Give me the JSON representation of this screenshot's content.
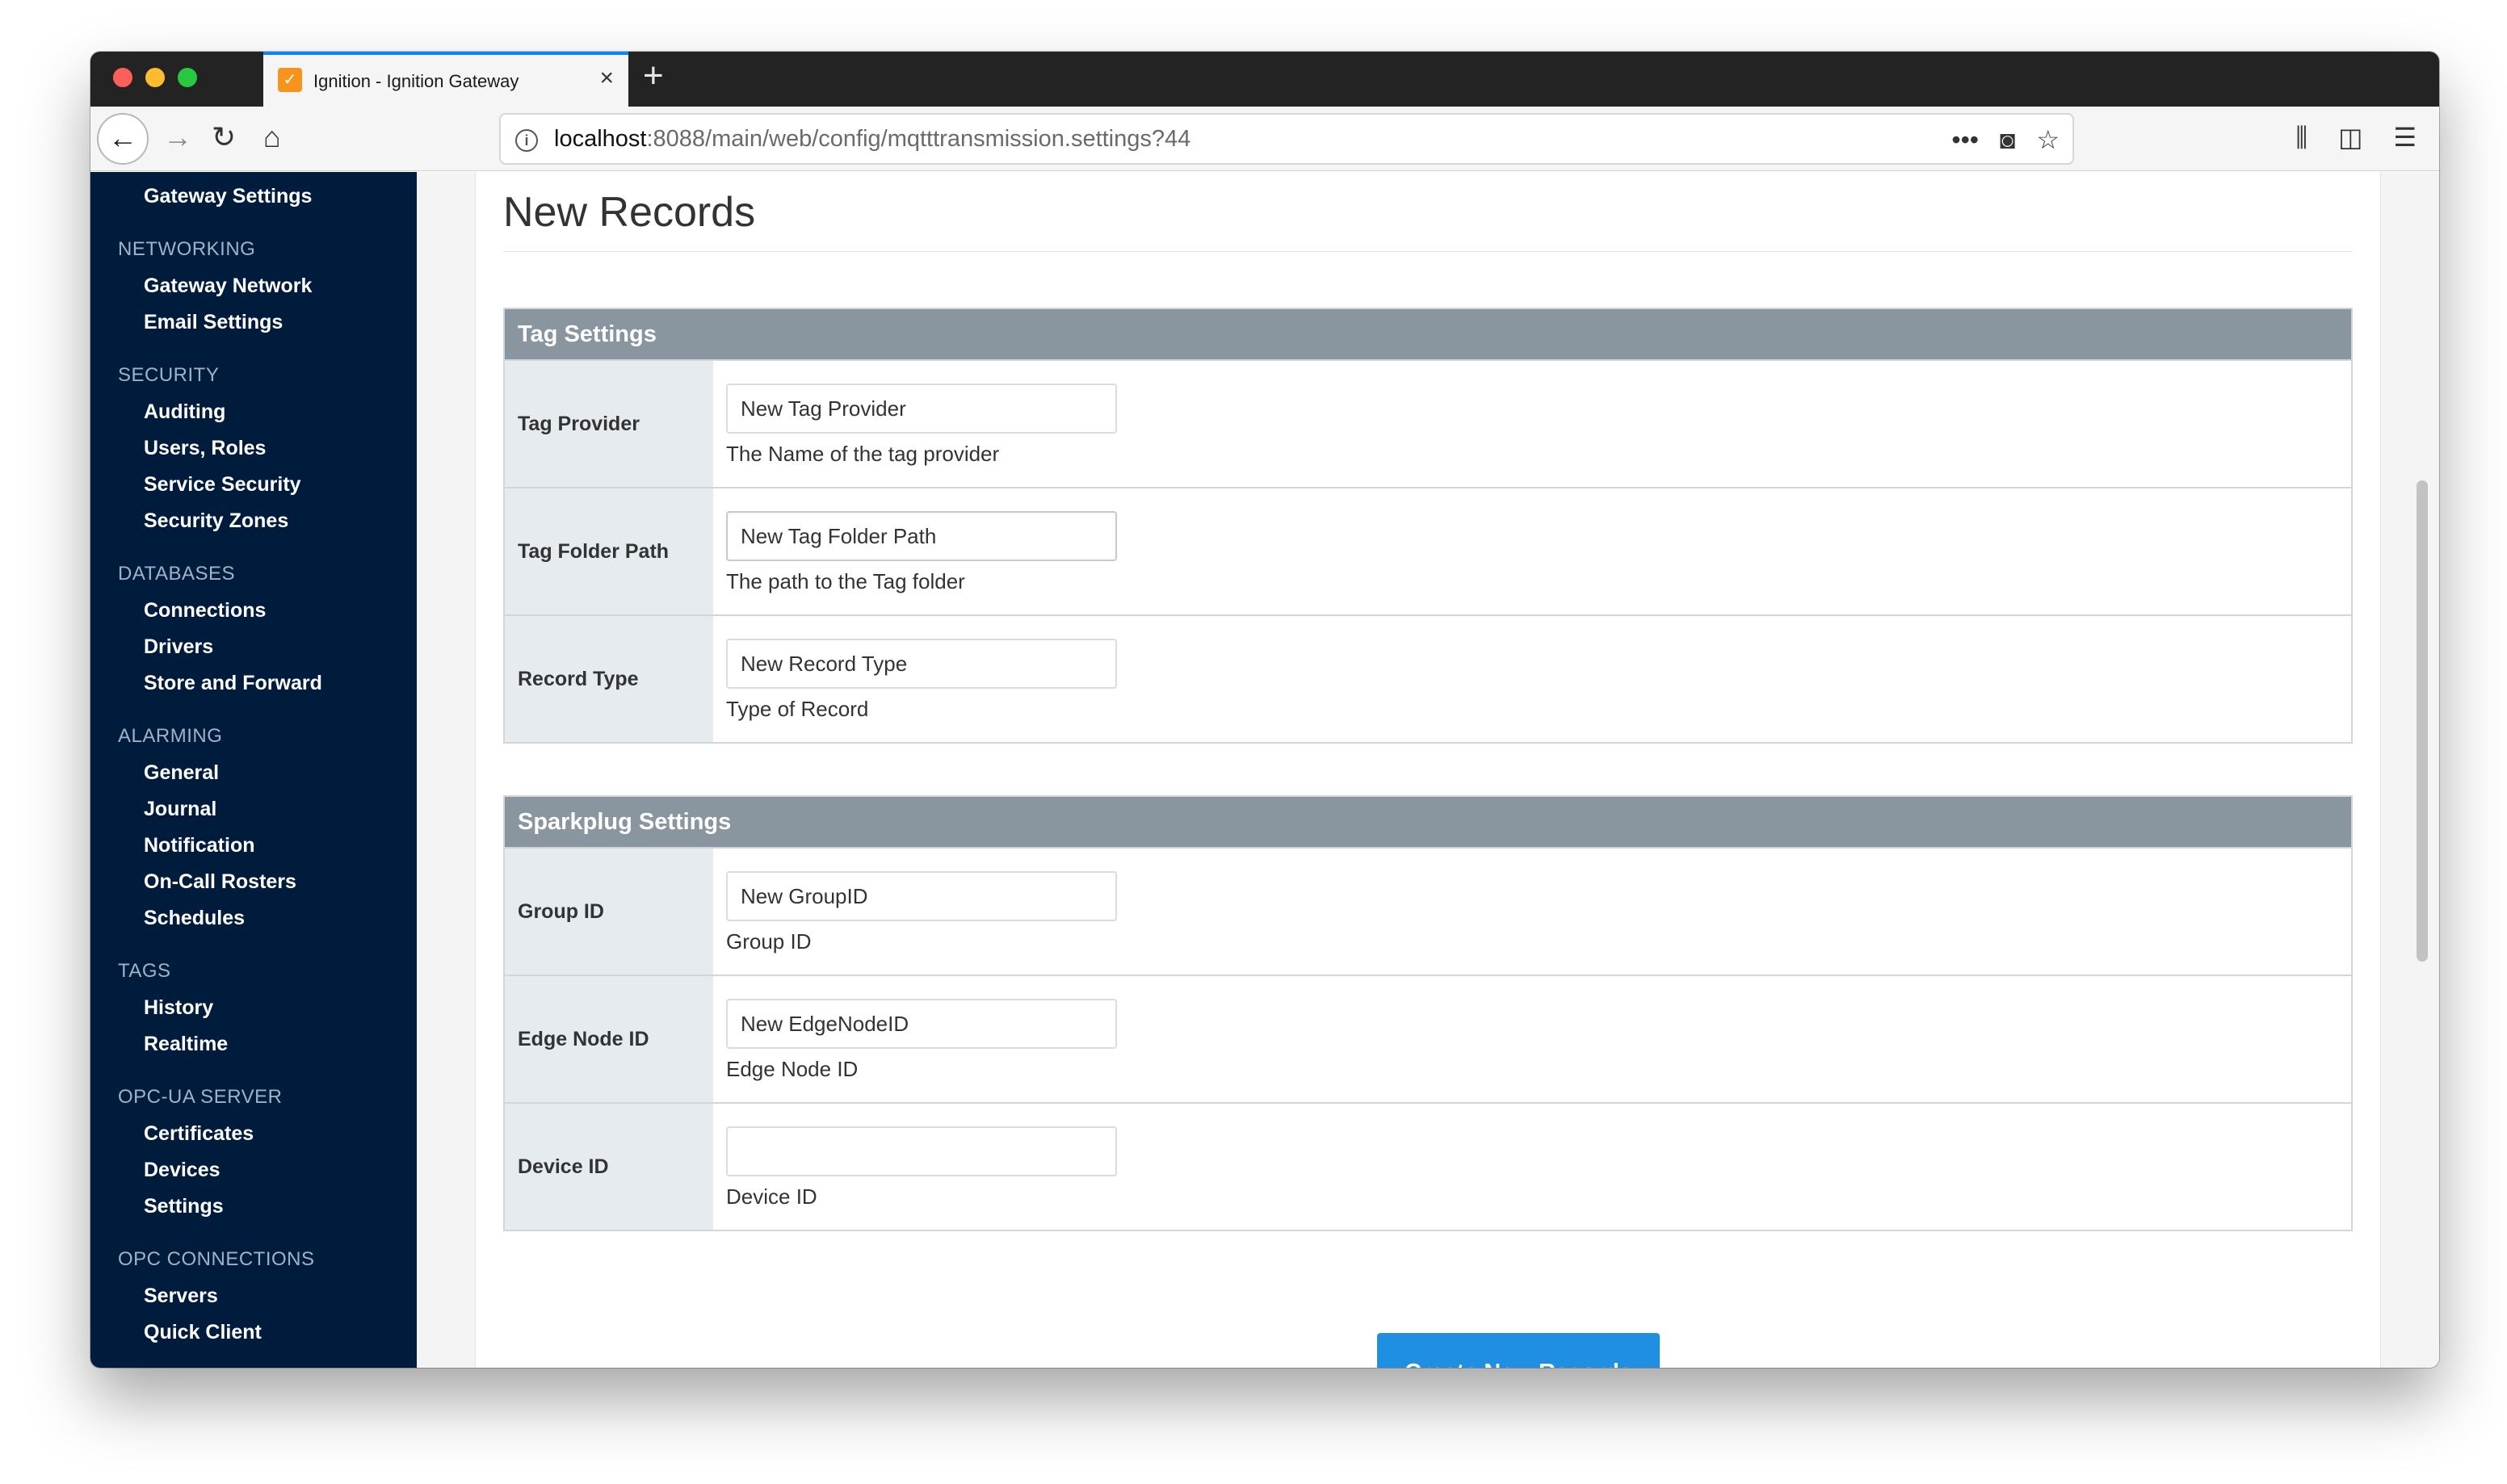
{
  "browser": {
    "tab_title": "Ignition - Ignition Gateway",
    "url_host": "localhost",
    "url_rest": ":8088/main/web/config/mqtttransmission.settings?44"
  },
  "sidebar": {
    "top_item": "Gateway Settings",
    "sections": [
      {
        "title": "NETWORKING",
        "items": [
          "Gateway Network",
          "Email Settings"
        ]
      },
      {
        "title": "SECURITY",
        "items": [
          "Auditing",
          "Users, Roles",
          "Service Security",
          "Security Zones"
        ]
      },
      {
        "title": "DATABASES",
        "items": [
          "Connections",
          "Drivers",
          "Store and Forward"
        ]
      },
      {
        "title": "ALARMING",
        "items": [
          "General",
          "Journal",
          "Notification",
          "On-Call Rosters",
          "Schedules"
        ]
      },
      {
        "title": "TAGS",
        "items": [
          "History",
          "Realtime"
        ]
      },
      {
        "title": "OPC-UA SERVER",
        "items": [
          "Certificates",
          "Devices",
          "Settings"
        ]
      },
      {
        "title": "OPC CONNECTIONS",
        "items": [
          "Servers",
          "Quick Client"
        ]
      }
    ]
  },
  "main": {
    "page_title": "New Records",
    "tag_settings": {
      "header": "Tag Settings",
      "rows": [
        {
          "label": "Tag Provider",
          "value": "New Tag Provider",
          "help": "The Name of the tag provider"
        },
        {
          "label": "Tag Folder Path",
          "value": "New Tag Folder Path",
          "help": "The path to the Tag folder"
        },
        {
          "label": "Record Type",
          "value": "New Record Type",
          "help": "Type of Record"
        }
      ]
    },
    "sparkplug_settings": {
      "header": "Sparkplug Settings",
      "rows": [
        {
          "label": "Group ID",
          "value": "New GroupID",
          "help": "Group ID"
        },
        {
          "label": "Edge Node ID",
          "value": "New EdgeNodeID",
          "help": "Edge Node ID"
        },
        {
          "label": "Device ID",
          "value": "",
          "help": "Device ID"
        }
      ]
    },
    "submit_label": "Create New Records"
  }
}
